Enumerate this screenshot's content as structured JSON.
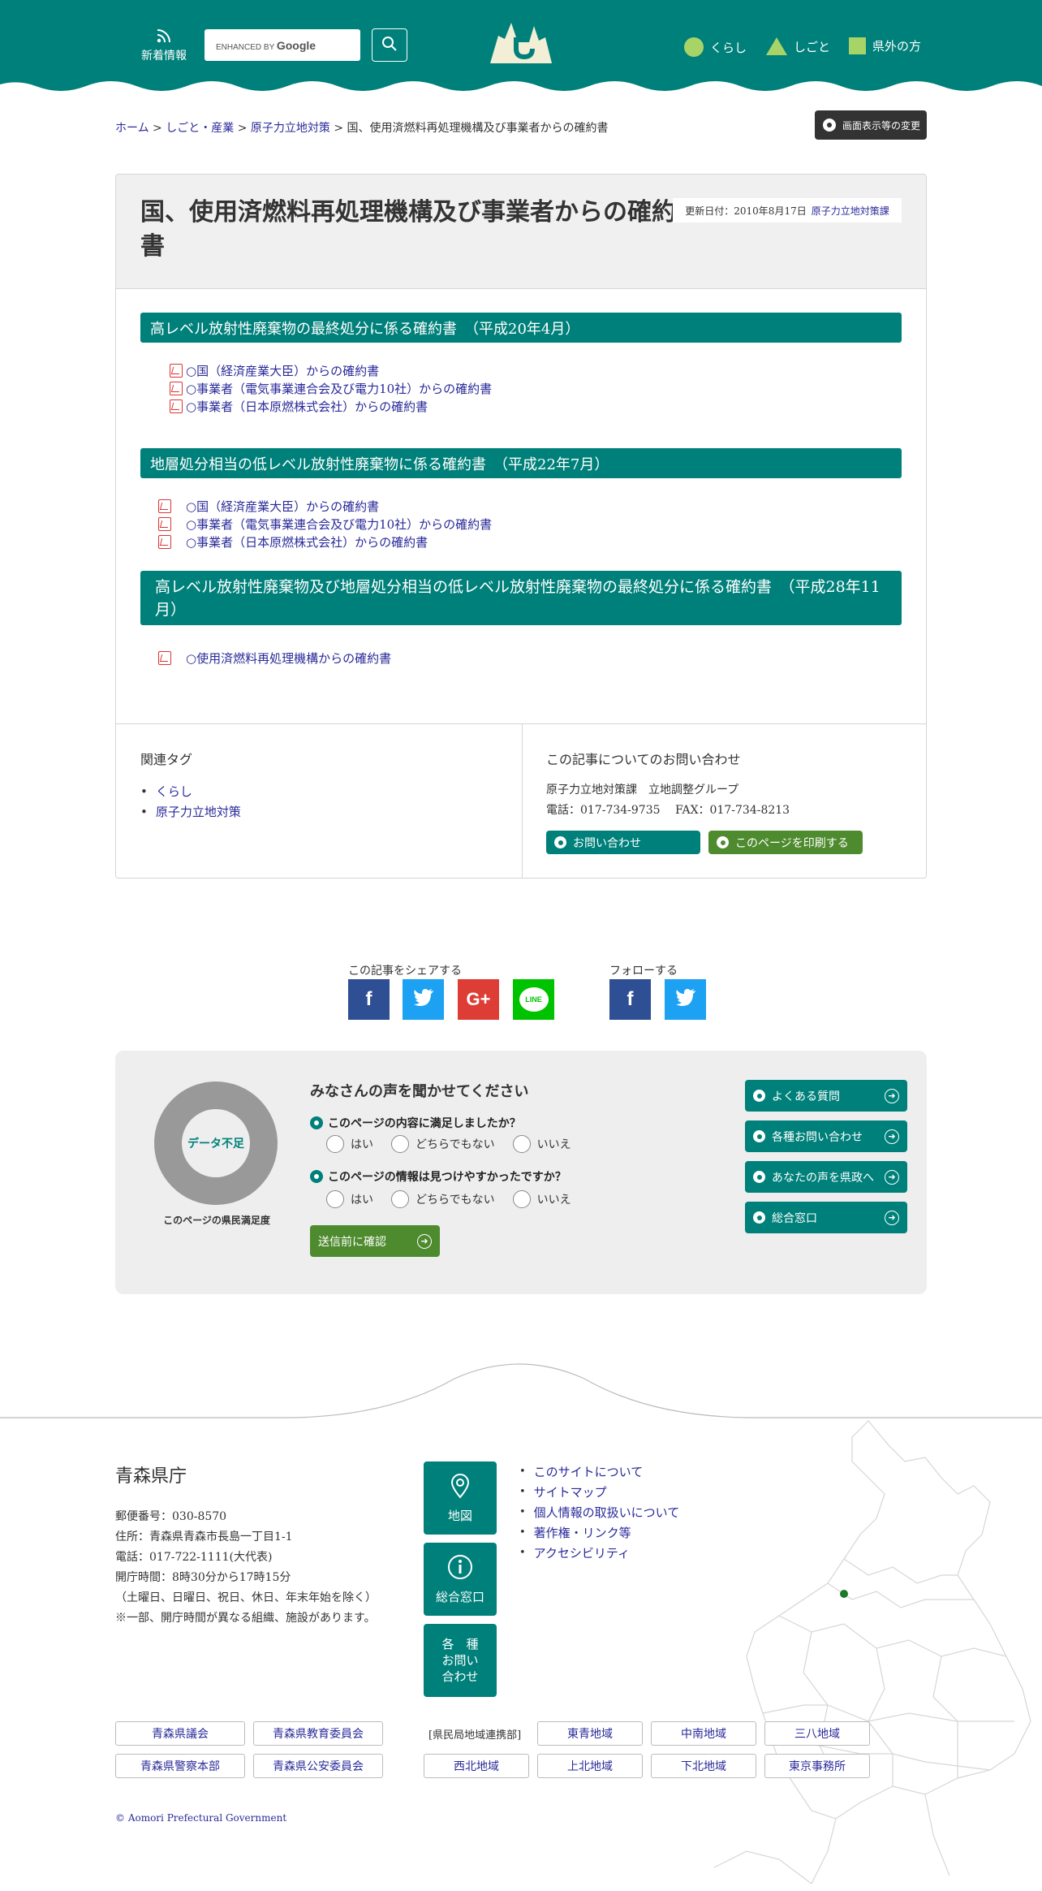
{
  "header": {
    "news_label": "新着情報",
    "search": {
      "enhanced_by": "ENHANCED BY",
      "google": "Google"
    },
    "nav": [
      {
        "label": "くらし",
        "shape": "circle"
      },
      {
        "label": "しごと",
        "shape": "triangle"
      },
      {
        "label": "県外の方",
        "shape": "square"
      }
    ],
    "colors": {
      "primary": "#00807a",
      "accent": "#a8d467",
      "logo_cream": "#f2efd6"
    }
  },
  "breadcrumb": {
    "items": [
      "ホーム",
      "しごと・産業",
      "原子力立地対策"
    ],
    "separator": ">",
    "current": "国、使用済燃料再処理機構及び事業者からの確約書"
  },
  "display_button": "画面表示等の変更",
  "article": {
    "title": "国、使用済燃料再処理機構及び事業者からの確約書",
    "updated_label": "更新日付：2010年8月17日",
    "department": "原子力立地対策課",
    "sections": [
      {
        "heading": "高レベル放射性廃棄物の最終処分に係る確約書　（平成20年4月）",
        "docs": [
          "○国（経済産業大臣）からの確約書",
          "○事業者（電気事業連合会及び電力10社）からの確約書",
          "○事業者（日本原燃株式会社）からの確約書"
        ]
      },
      {
        "heading": "地層処分相当の低レベル放射性廃棄物に係る確約書　（平成22年7月）",
        "docs": [
          "○国（経済産業大臣）からの確約書",
          "○事業者（電気事業連合会及び電力10社）からの確約書",
          "○事業者（日本原燃株式会社）からの確約書"
        ]
      },
      {
        "heading": "高レベル放射性廃棄物及び地層処分相当の低レベル放射性廃棄物の最終処分に係る確約書　（平成28年11月）",
        "docs": [
          "○使用済燃料再処理機構からの確約書"
        ]
      }
    ],
    "related_tags": {
      "title": "関連タグ",
      "items": [
        "くらし",
        "原子力立地対策"
      ]
    },
    "contact": {
      "title": "この記事についてのお問い合わせ",
      "org": "原子力立地対策課　立地調整グループ",
      "phone": "電話：017-734-9735　 FAX：017-734-8213",
      "inquiry_button": "お問い合わせ",
      "print_button": "このページを印刷する"
    }
  },
  "share": {
    "share_label": "この記事をシェアする",
    "follow_label": "フォローする",
    "share_icons": [
      "facebook-icon",
      "twitter-icon",
      "google-plus-icon",
      "line-icon"
    ],
    "follow_icons": [
      "facebook-icon",
      "twitter-icon"
    ],
    "glyphs": {
      "facebook": "f",
      "google": "G+",
      "line": "LINE"
    }
  },
  "survey": {
    "gauge_label": "データ不足",
    "gauge_caption": "このページの県民満足度",
    "title": "みなさんの声を聞かせてください",
    "questions": [
      {
        "text": "このページの内容に満足しましたか？",
        "options": [
          "はい",
          "どちらでもない",
          "いいえ"
        ]
      },
      {
        "text": "このページの情報は見つけやすかったですか？",
        "options": [
          "はい",
          "どちらでもない",
          "いいえ"
        ]
      }
    ],
    "confirm_button": "送信前に確認",
    "side_buttons": [
      "よくある質問",
      "各種お問い合わせ",
      "あなたの声を県政へ",
      "総合窓口"
    ]
  },
  "footer": {
    "name": "青森県庁",
    "address_lines": [
      "郵便番号：030-8570",
      "住所：青森県青森市長島一丁目1-1",
      "電話：017-722-1111(大代表)",
      "開庁時間：8時30分から17時15分",
      "（土曜日、日曜日、祝日、休日、年末年始を除く）",
      "※一部、開庁時間が異なる組織、施設があります。"
    ],
    "big_buttons": [
      {
        "label": "地図",
        "icon": "map-pin-icon"
      },
      {
        "label": "総合窓口",
        "icon": "info-icon"
      },
      {
        "label_lines": [
          "各　種",
          "お問い",
          "合わせ"
        ],
        "icon": ""
      }
    ],
    "links": [
      "このサイトについて",
      "サイトマップ",
      "個人情報の取扱いについて",
      "著作権・リンク等",
      "アクセシビリティ"
    ],
    "org_links": [
      "青森県議会",
      "青森県教育委員会",
      "青森県警察本部",
      "青森県公安委員会"
    ],
    "region_label": "[県民局地域連携部]",
    "regions": [
      "東青地域",
      "中南地域",
      "三八地域",
      "西北地域",
      "上北地域",
      "下北地域",
      "東京事務所"
    ],
    "copyright": "© Aomori Prefectural Government"
  }
}
